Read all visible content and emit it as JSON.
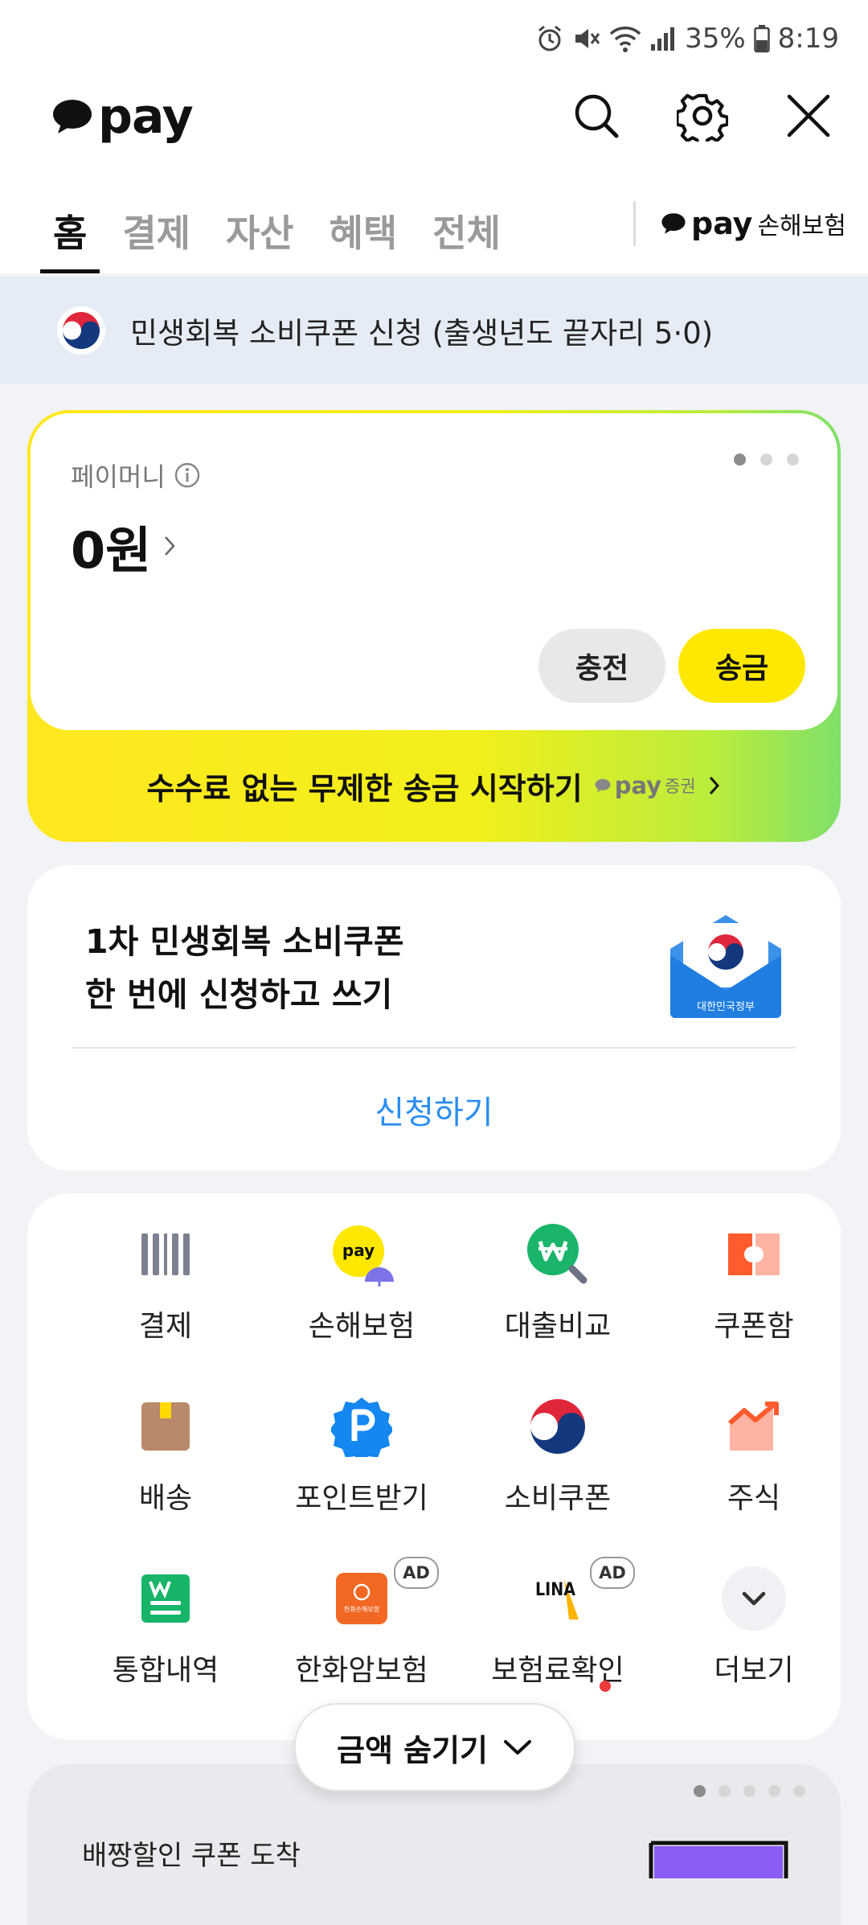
{
  "status_bar": {
    "battery": "35%",
    "time": "8:19"
  },
  "header": {
    "logo_text": "pay",
    "tabs": [
      {
        "label": "홈",
        "active": true
      },
      {
        "label": "결제",
        "active": false
      },
      {
        "label": "자산",
        "active": false
      },
      {
        "label": "혜택",
        "active": false
      },
      {
        "label": "전체",
        "active": false
      }
    ],
    "insurance_brand": "pay",
    "insurance_label": "손해보험"
  },
  "notice": {
    "text": "민생회복 소비쿠폰 신청 (출생년도 끝자리 5·0)"
  },
  "paymoney": {
    "label": "페이머니",
    "amount": "0원",
    "charge_label": "충전",
    "send_label": "송금",
    "promo_text": "수수료 없는 무제한 송금 시작하기",
    "promo_brand": "pay",
    "promo_brand_suffix": "증권"
  },
  "coupon_card": {
    "title_line1": "1차 민생회복 소비쿠폰",
    "title_line2": "한 번에 신청하고 쓰기",
    "envelope_text": "대한민국정부",
    "cta_label": "신청하기"
  },
  "menu": {
    "items": [
      {
        "label": "결제",
        "icon": "barcode-icon"
      },
      {
        "label": "손해보험",
        "icon": "pay-insurance-icon",
        "icon_text": "pay"
      },
      {
        "label": "대출비교",
        "icon": "loan-compare-icon"
      },
      {
        "label": "쿠폰함",
        "icon": "coupon-box-icon"
      },
      {
        "label": "배송",
        "icon": "package-icon"
      },
      {
        "label": "포인트받기",
        "icon": "point-icon"
      },
      {
        "label": "소비쿠폰",
        "icon": "taegeuk-icon"
      },
      {
        "label": "주식",
        "icon": "stock-chart-icon"
      },
      {
        "label": "통합내역",
        "icon": "history-icon"
      },
      {
        "label": "한화암보험",
        "icon": "hanwha-icon",
        "ad": "AD",
        "icon_text": "한화손해보험"
      },
      {
        "label": "보험료확인",
        "icon": "lina-icon",
        "ad": "AD",
        "icon_text": "LINA"
      },
      {
        "label": "더보기",
        "icon": "chevron-down-icon"
      }
    ]
  },
  "hide_amount": {
    "label": "금액 숨기기"
  },
  "bottom_banner": {
    "text": "배짱할인 쿠폰 도착"
  },
  "colors": {
    "yellow": "#ffe800",
    "blue_link": "#2a8df0",
    "notice_bg": "#e6ecf5"
  }
}
